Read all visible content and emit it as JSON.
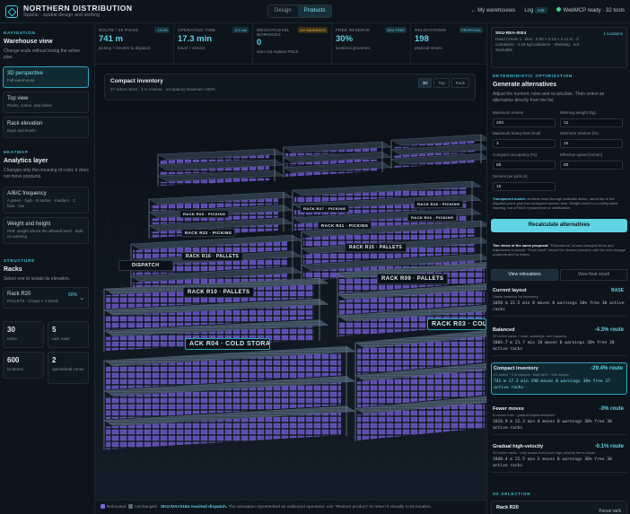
{
  "header": {
    "title": "NORTHERN DISTRIBUTION",
    "subtitle": "Spacio · spatial design and slotting",
    "tabs": [
      {
        "label": "Design"
      },
      {
        "label": "Products"
      }
    ],
    "my_warehouses": "← My warehouses",
    "log_label": "Log",
    "log_badge": "246",
    "status": "WebMCP ready · 32 tools"
  },
  "sidebar": {
    "nav_section": "NAVIGATION",
    "nav_title": "Warehouse view",
    "nav_desc": "Change scale without losing the active plan.",
    "views": [
      {
        "label": "3D perspective",
        "desc": "Full warehouse"
      },
      {
        "label": "Top view",
        "desc": "Racks, zones, and aisles"
      },
      {
        "label": "Rack elevation",
        "desc": "Bays and levels"
      }
    ],
    "heatmap_section": "HEATMAP",
    "heatmap_title": "Analytics layer",
    "heatmap_desc": "Changes only the meaning of color; it does not move products.",
    "layers": [
      {
        "label": "A/B/C frequency",
        "desc": "A green · high · B amber · medium · C blue · low"
      },
      {
        "label": "Weight and height",
        "desc": "Red: weight above the allowed level · dark: no warning"
      }
    ],
    "structure_section": "STRUCTURE",
    "structure_title": "Racks",
    "structure_desc": "Select one to isolate its elevation.",
    "rack_select": {
      "label": "Rack R20",
      "detail": "PALLETS · 3 bays × 4 levels",
      "pct": "60%"
    },
    "stats": [
      {
        "value": "30",
        "label": "racks"
      },
      {
        "value": "5",
        "label": "rack rows"
      },
      {
        "value": "600",
        "label": "locations"
      },
      {
        "value": "2",
        "label": "operational zones"
      }
    ]
  },
  "kpis": [
    {
      "label": "ROUTE / 20 PICKS",
      "tag": "-19.6%",
      "value": "741 m",
      "sub": "picking + transfer to dispatch",
      "warn": false
    },
    {
      "label": "OPERATING TIME",
      "tag": "-9.3 min",
      "value": "17.3 min",
      "sub": "travel + service",
      "warn": false
    },
    {
      "label": "WEIGHT/LEVEL WARNINGS",
      "tag": "NO WARNINGS",
      "value": "0",
      "sub": "does not replace RNLE",
      "warn": true
    },
    {
      "label": "FREE RESERVE",
      "tag": "30% FREE",
      "value": "30%",
      "sub": "locations geometric",
      "warn": false
    },
    {
      "label": "RELOCATIONS",
      "tag": "PROPOSAL",
      "value": "198",
      "sub": "physical moves",
      "warn": false
    }
  ],
  "scene": {
    "title": "Compact inventory",
    "subtitle": "27 active racks · 3 m reserve · occupancy maximum 100%",
    "view_buttons": [
      {
        "label": "3D"
      },
      {
        "label": "Top"
      },
      {
        "label": "Rack"
      }
    ],
    "rack_labels": [
      {
        "text": "RACK R08 · PICKING"
      },
      {
        "text": "RACK R27 · PICKING"
      },
      {
        "text": "RACK R28 · PICKING"
      },
      {
        "text": "RACK R22 · PICKING"
      },
      {
        "text": "RACK R21 · PICKING"
      },
      {
        "text": "RACK R26 · PICKING"
      },
      {
        "text": "RACK R15 · PALLETS"
      },
      {
        "text": "RACK R16 · PALLETS"
      },
      {
        "text": "DISPATCH"
      },
      {
        "text": "RACK R10 · PALLETS"
      },
      {
        "text": "RACK R09 · PALLETS"
      },
      {
        "text": "ACK R04 · COLD STORAGE"
      },
      {
        "text": "RACK R03 · COLD STORAGE"
      }
    ],
    "legend_relocated": "Relocated",
    "legend_unchanged": "Unchanged",
    "footer_highlight": "SKU-DAI-0184 reached dispatch.",
    "footer_text": "The animation represented an outbound operation; use \"Restore product\" to return it visually to its location."
  },
  "sku_card": {
    "code": "SKU-REA-0004",
    "locations": "1 locations",
    "desc": "Hand Cream 1 · Box · 0.20 × 0.19 × 0.11 m · 2 containers · 2.28 kg/containers · Shelving · not stackable"
  },
  "optimizer": {
    "section": "DETERMINISTIC OPTIMIZATION",
    "title": "Generate alternatives",
    "desc": "Adjust the numeric rules and recalculate. Then select an alternative directly from the list.",
    "fields": [
      {
        "label": "Maximum moves",
        "value": "200"
      },
      {
        "label": "Warning weight (kg)",
        "value": "12"
      },
      {
        "label": "Maximum heavy-item level",
        "value": "3"
      },
      {
        "label": "Minimum reserve (%)",
        "value": "15"
      },
      {
        "label": "Compact occupancy (%)",
        "value": "85"
      },
      {
        "label": "Effective speed (m/min)",
        "value": "60"
      },
      {
        "label": "Service per pick (s)",
        "value": "15"
      }
    ],
    "note_strong": "Transparent model:",
    "note": "shortest route through walkable aisles, round trip to the dispatch point, plus the configured service time. Weight check is a configurable warning, not a RNLE replacement or certification.",
    "recalc": "Recalculate alternatives",
    "views_note_strong": "Two views of the same proposal:",
    "views_note": "\"Relocations\" shows changed items and trajectories in purple; \"Final result\" shows the chosen scenario with the new storage positions and no traces."
  },
  "result_tabs": [
    {
      "label": "View relocations"
    },
    {
      "label": "View final result"
    }
  ],
  "alternatives": [
    {
      "name": "Current layout",
      "desc": "Stable baseline for inventory",
      "metrics": "1050 m 22.5 min 0 moves 0 warnings 30% free 30 active racks",
      "result": "BASE"
    },
    {
      "name": "Balanced",
      "desc": "30 active racks · route, warnings, and capacity",
      "metrics": "1004.7 m 21.7 min 18 moves 0 warnings 30% free 30 active racks",
      "result": "-4.3% route"
    },
    {
      "name": "Compact inventory",
      "desc": "27 active · 3 m reserve · limit 85% · 198 moves",
      "metrics": "741 m 17.3 min 198 moves 0 warnings 30% free 27 active racks",
      "result": "-29.4% route"
    },
    {
      "name": "Fewer moves",
      "desc": "8 moves max · gradual implementation",
      "metrics": "1018.9 m 22.3 min 4 moves 0 warnings 30% free 30 active racks",
      "result": "-3% route"
    },
    {
      "name": "Gradual high-velocity",
      "desc": "30 active racks · only swaps that move high-velocity items closer",
      "metrics": "1048.4 m 22.5 min 2 moves 0 warnings 30% free 30 active racks",
      "result": "-0.1% route"
    }
  ],
  "selection": {
    "section": "3D SELECTION",
    "rack": "Rack R20",
    "action": "Focus rack"
  }
}
